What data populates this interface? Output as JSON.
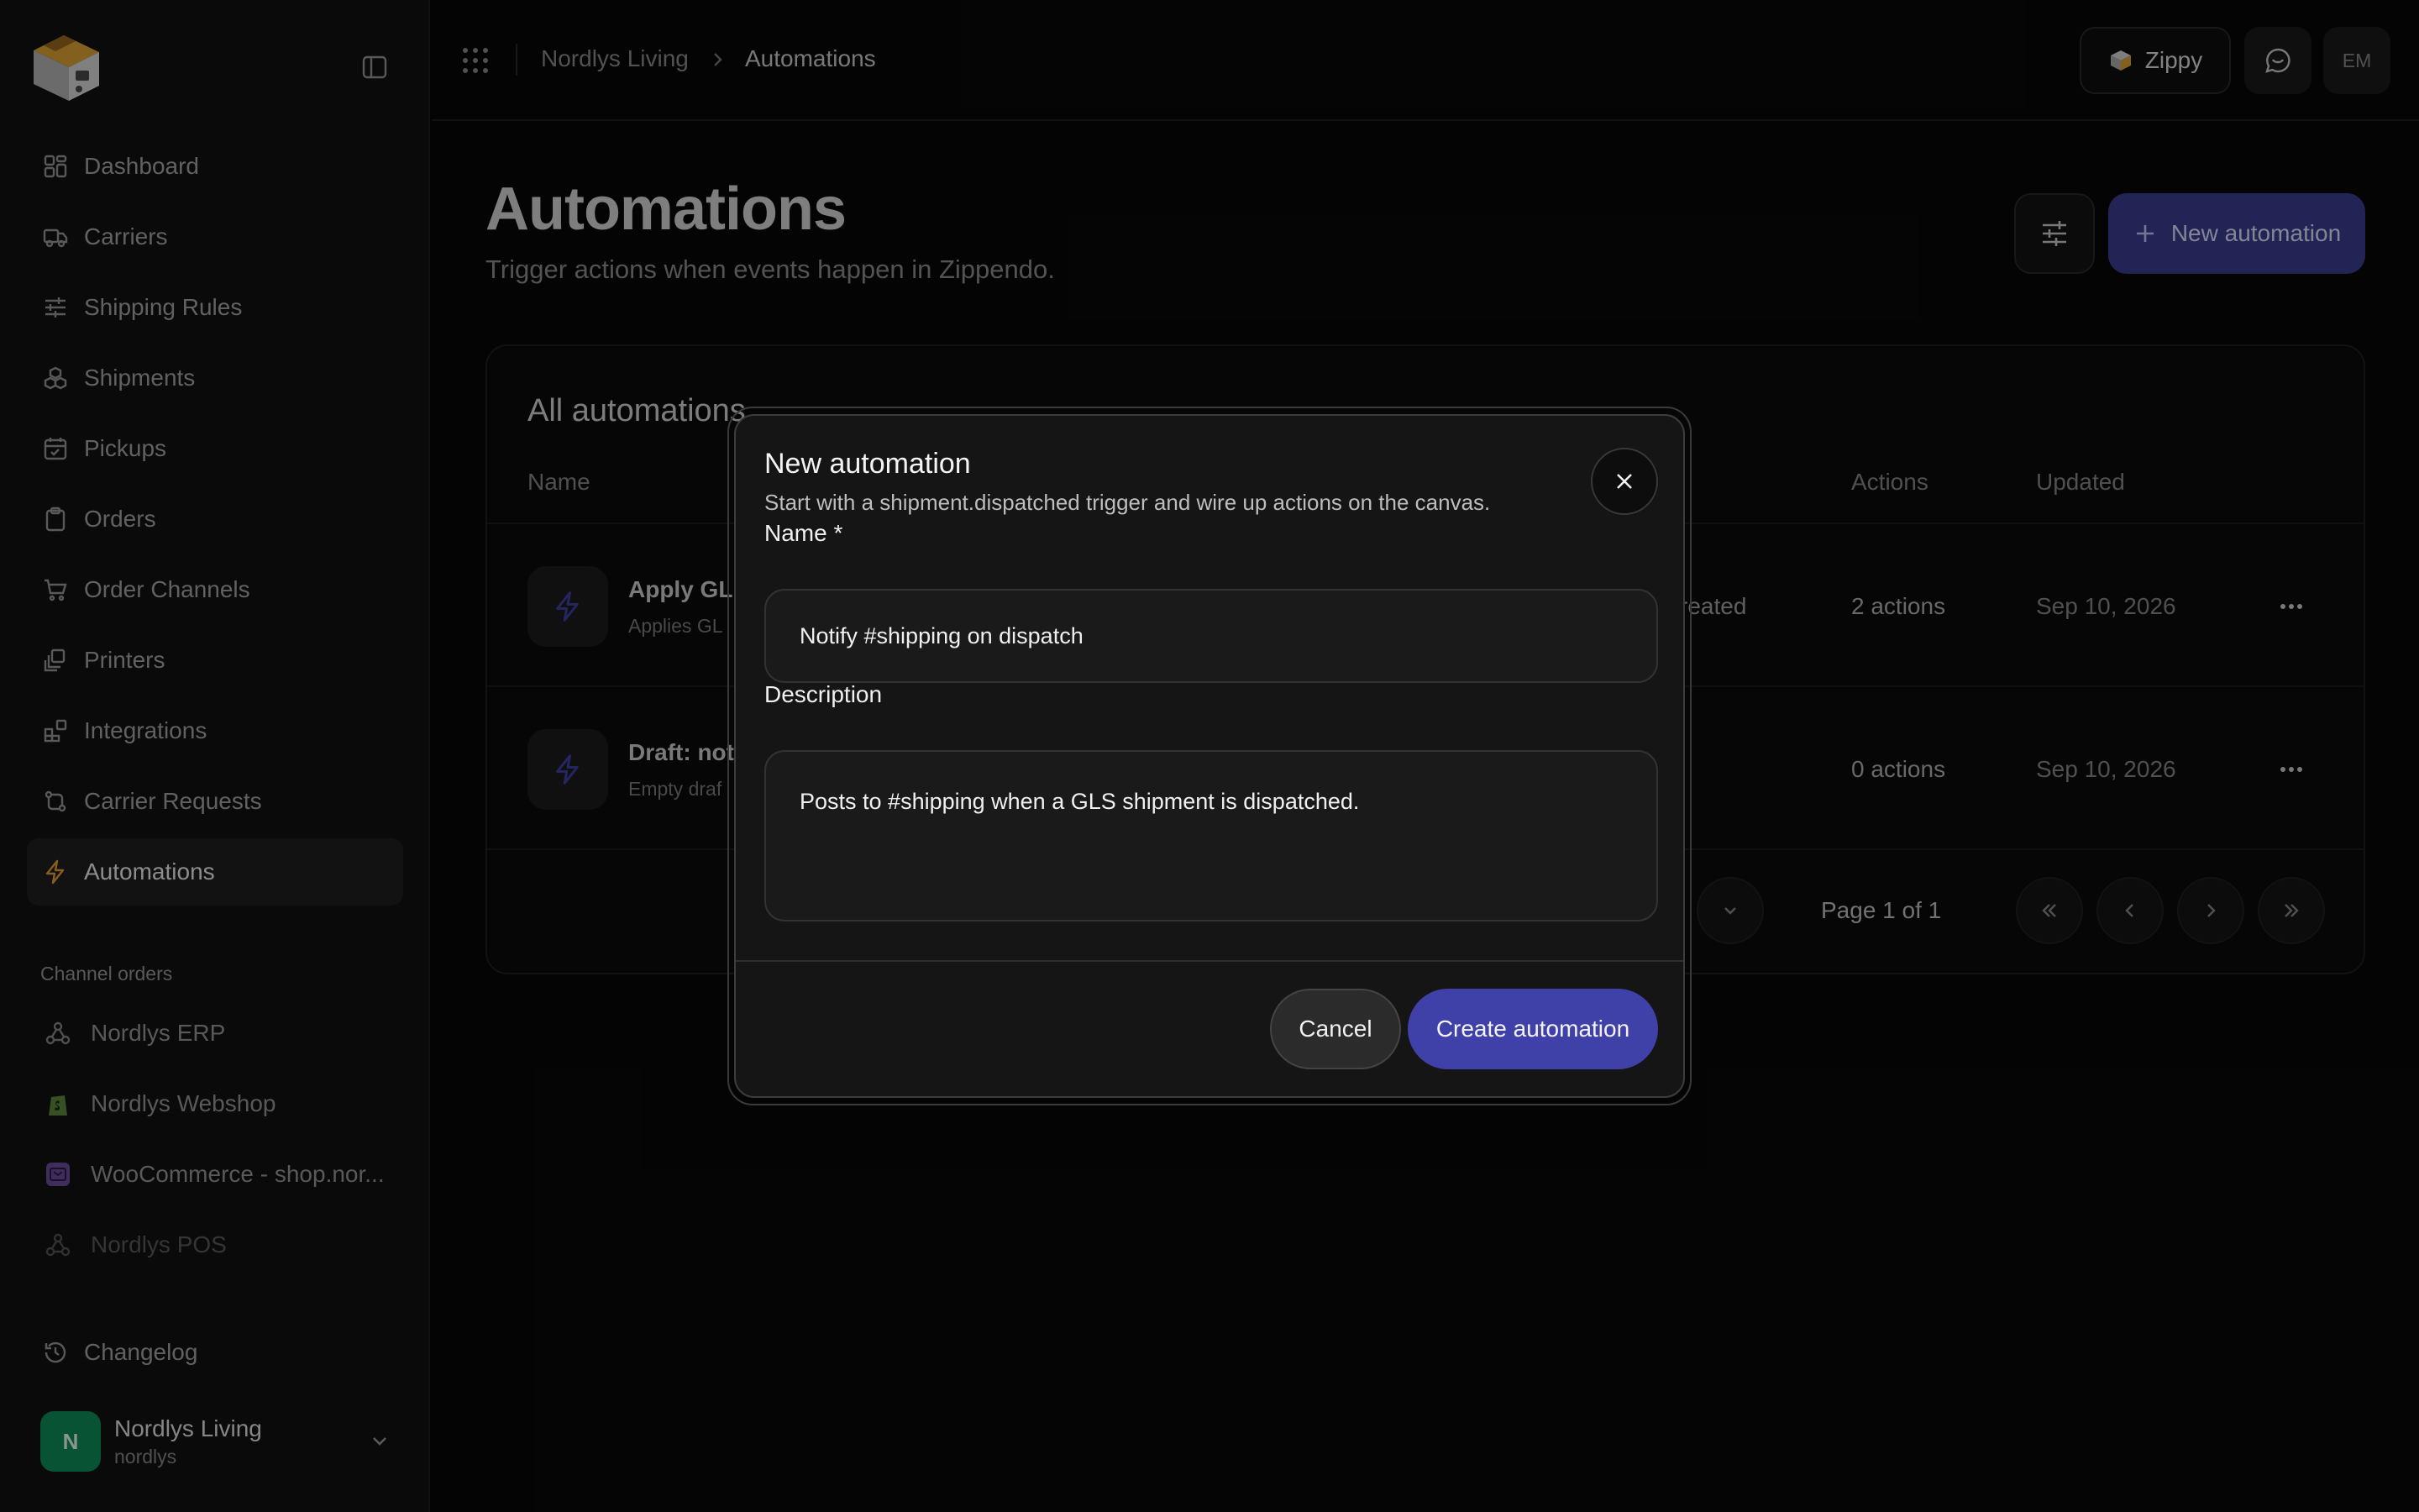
{
  "sidebar": {
    "nav": [
      {
        "label": "Dashboard",
        "icon": "dashboard-icon"
      },
      {
        "label": "Carriers",
        "icon": "truck-icon"
      },
      {
        "label": "Shipping Rules",
        "icon": "sliders-icon"
      },
      {
        "label": "Shipments",
        "icon": "boxes-icon"
      },
      {
        "label": "Pickups",
        "icon": "calendar-check-icon"
      },
      {
        "label": "Orders",
        "icon": "clipboard-icon"
      },
      {
        "label": "Order Channels",
        "icon": "cart-icon"
      },
      {
        "label": "Printers",
        "icon": "printer-icon"
      },
      {
        "label": "Integrations",
        "icon": "blocks-icon"
      },
      {
        "label": "Carrier Requests",
        "icon": "route-icon"
      },
      {
        "label": "Automations",
        "icon": "bolt-icon",
        "active": true
      }
    ],
    "section_label": "Channel orders",
    "channels": [
      {
        "label": "Nordlys ERP",
        "icon": "webhook-icon"
      },
      {
        "label": "Nordlys Webshop",
        "icon": "shopify-icon"
      },
      {
        "label": "WooCommerce - shop.nor...",
        "icon": "woocommerce-icon"
      },
      {
        "label": "Nordlys POS",
        "icon": "webhook-icon"
      }
    ],
    "changelog": "Changelog",
    "user": {
      "initial": "N",
      "name": "Nordlys Living",
      "handle": "nordlys"
    }
  },
  "topbar": {
    "breadcrumb": [
      "Nordlys Living",
      "Automations"
    ],
    "zippy_label": "Zippy",
    "user_initials": "EM"
  },
  "page": {
    "title": "Automations",
    "subtitle": "Trigger actions when events happen in Zippendo.",
    "new_button": "New automation"
  },
  "table": {
    "title": "All automations",
    "columns": {
      "name": "Name",
      "actions": "Actions",
      "updated": "Updated"
    },
    "rows": [
      {
        "name": "Apply GL",
        "desc": "Applies GL",
        "trigger": "reated",
        "actions": "2 actions",
        "updated": "Sep 10, 2026"
      },
      {
        "name": "Draft: not",
        "desc": "Empty draf",
        "trigger": "",
        "actions": "0 actions",
        "updated": "Sep 10, 2026"
      }
    ],
    "pager": "Page 1 of 1"
  },
  "dialog": {
    "title": "New automation",
    "subtitle": "Start with a shipment.dispatched trigger and wire up actions on the canvas.",
    "name_label": "Name *",
    "name_value": "Notify #shipping on dispatch",
    "description_label": "Description",
    "description_value": "Posts to #shipping when a GLS shipment is dispatched.",
    "cancel": "Cancel",
    "create": "Create automation"
  },
  "colors": {
    "accent": "#3f41a8",
    "accent_sidebar": "#e8a33a",
    "avatar": "#0e8f5a",
    "background": "#080808"
  }
}
